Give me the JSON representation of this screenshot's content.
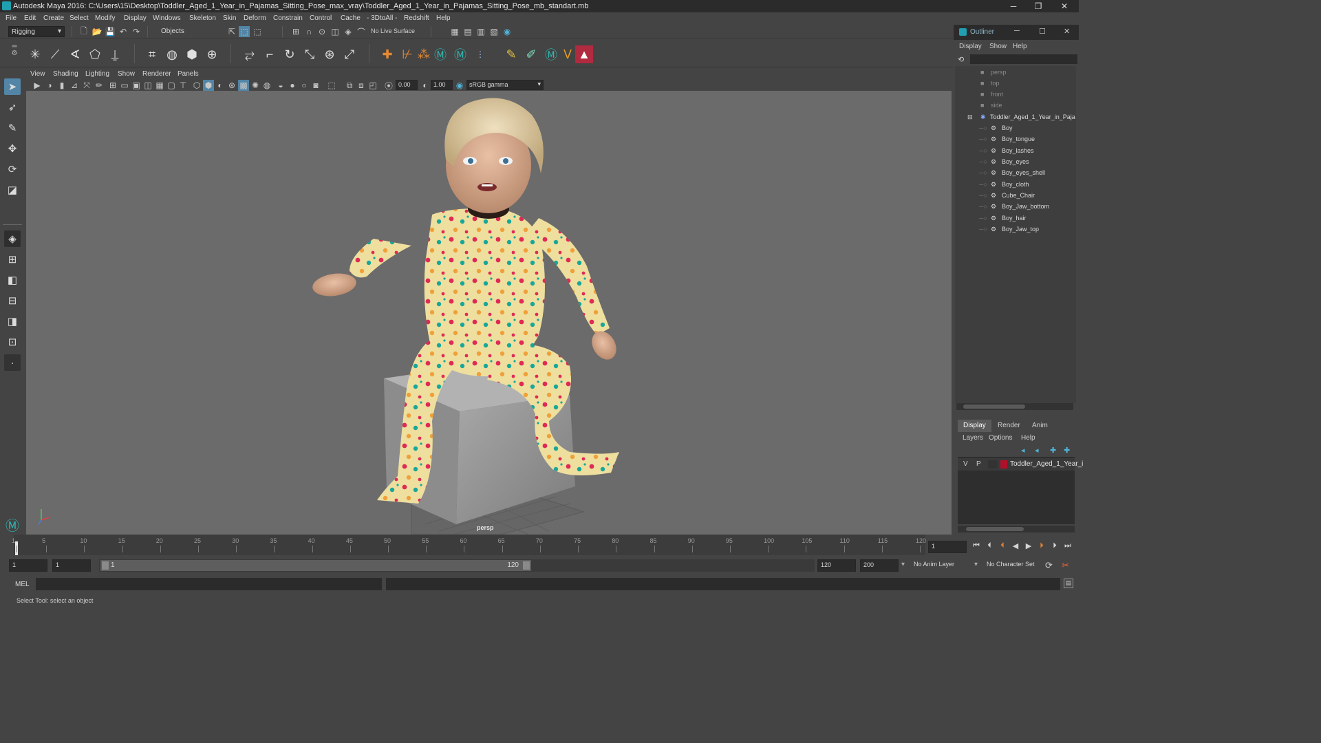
{
  "window": {
    "title": "Autodesk Maya 2016: C:\\Users\\15\\Desktop\\Toddler_Aged_1_Year_in_Pajamas_Sitting_Pose_max_vray\\Toddler_Aged_1_Year_in_Pajamas_Sitting_Pose_mb_standart.mb"
  },
  "menubar": [
    "File",
    "Edit",
    "Create",
    "Select",
    "Modify",
    "Display",
    "Windows",
    "Skeleton",
    "Skin",
    "Deform",
    "Constrain",
    "Control",
    "Cache",
    "- 3DtoAll -",
    "Redshift",
    "Help"
  ],
  "statusline": {
    "menuset": "Rigging",
    "selection_mode": "Objects",
    "live_surface": "No Live Surface"
  },
  "panel_menu": [
    "View",
    "Shading",
    "Lighting",
    "Show",
    "Renderer",
    "Panels"
  ],
  "view_toolbar": {
    "exposure": "0.00",
    "gamma": "1.00",
    "color_space": "sRGB gamma"
  },
  "viewport": {
    "camera_label": "persp",
    "background": "#6b6b6b"
  },
  "outliner": {
    "title": "Outliner",
    "menu": [
      "Display",
      "Show",
      "Help"
    ],
    "cameras": [
      "persp",
      "top",
      "front",
      "side"
    ],
    "group": "Toddler_Aged_1_Year_in_Paja",
    "children": [
      "Boy",
      "Boy_tongue",
      "Boy_lashes",
      "Boy_eyes",
      "Boy_eyes_shell",
      "Boy_cloth",
      "Cube_Chair",
      "Boy_Jaw_bottom",
      "Boy_hair",
      "Boy_Jaw_top"
    ]
  },
  "layer_editor": {
    "tabs": [
      "Display",
      "Render",
      "Anim"
    ],
    "menu": [
      "Layers",
      "Options",
      "Help"
    ],
    "layer": {
      "v": "V",
      "p": "P",
      "name": "Toddler_Aged_1_Year_i",
      "color": "#b0102a"
    }
  },
  "timeline": {
    "ticks": [
      "1",
      "5",
      "10",
      "15",
      "20",
      "25",
      "30",
      "35",
      "40",
      "45",
      "50",
      "55",
      "60",
      "65",
      "70",
      "75",
      "80",
      "85",
      "90",
      "95",
      "100",
      "105",
      "110",
      "115",
      "120"
    ],
    "current_frame": "1"
  },
  "range": {
    "start": "1",
    "playback_start": "1",
    "slider_start": "1",
    "slider_end": "120",
    "playback_end": "120",
    "end": "200",
    "anim_layer": "No Anim Layer",
    "character_set": "No Character Set"
  },
  "cmdline": {
    "label": "MEL"
  },
  "helpline": {
    "text": "Select Tool: select an object"
  }
}
